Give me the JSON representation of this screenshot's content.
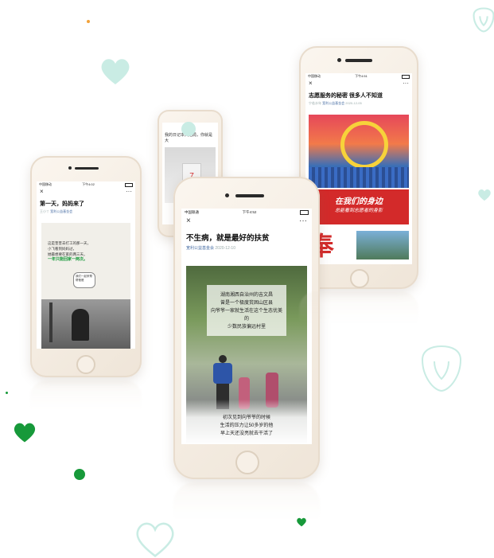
{
  "phone_left": {
    "carrier": "中国移动",
    "time": "下午4:02",
    "close_icon": "×",
    "more_icon": "···",
    "title": "第一天，妈妈来了",
    "meta_prefix": "王小丫",
    "meta_account": "宽利公益基金会",
    "poster_lines": [
      "这是奎奎去打工的那一天，",
      "小飞看到妈妈过，",
      "她最想要在家的两三天。"
    ],
    "poster_highlight": "一年只能回家一两次。",
    "tag_text": "我们一起来帮帮爸爸"
  },
  "phone_small": {
    "title": "我的日记本大结局，你就是大",
    "badge": "7"
  },
  "phone_center": {
    "carrier": "中国联通",
    "time": "下午4:52",
    "close_icon": "×",
    "more_icon": "···",
    "title": "不生病，就是最好的扶贫",
    "meta_account": "宽利公益基金会",
    "meta_date": "2020-12-10",
    "overlay_lines": [
      "湖南湘西自治州的吉文昌",
      "曾是一个极度贫困山区县",
      "向爷爷一家就生活在这个生态优美的",
      "少数民族偏远村里"
    ],
    "bottom_lines": [
      "初次见到向爷爷的时候",
      "生活的压力让50多岁的他",
      "早上天还没亮就去干活了"
    ]
  },
  "phone_right": {
    "carrier": "中国移动",
    "time": "下午4:51",
    "close_icon": "×",
    "more_icon": "···",
    "title": "志愿服务的秘密 很多人不知道",
    "meta_prefix": "宁若水年",
    "meta_account": "宽利公益基金会",
    "meta_date": "2020-12-05",
    "banner_line1": "在我们的身边",
    "banner_line2": "总能看到志愿者的身影",
    "banner_char": "奉"
  },
  "colors": {
    "mint": "#c9ece4",
    "green": "#17993a",
    "orange": "#f2a23a",
    "red": "#d32a2a"
  }
}
